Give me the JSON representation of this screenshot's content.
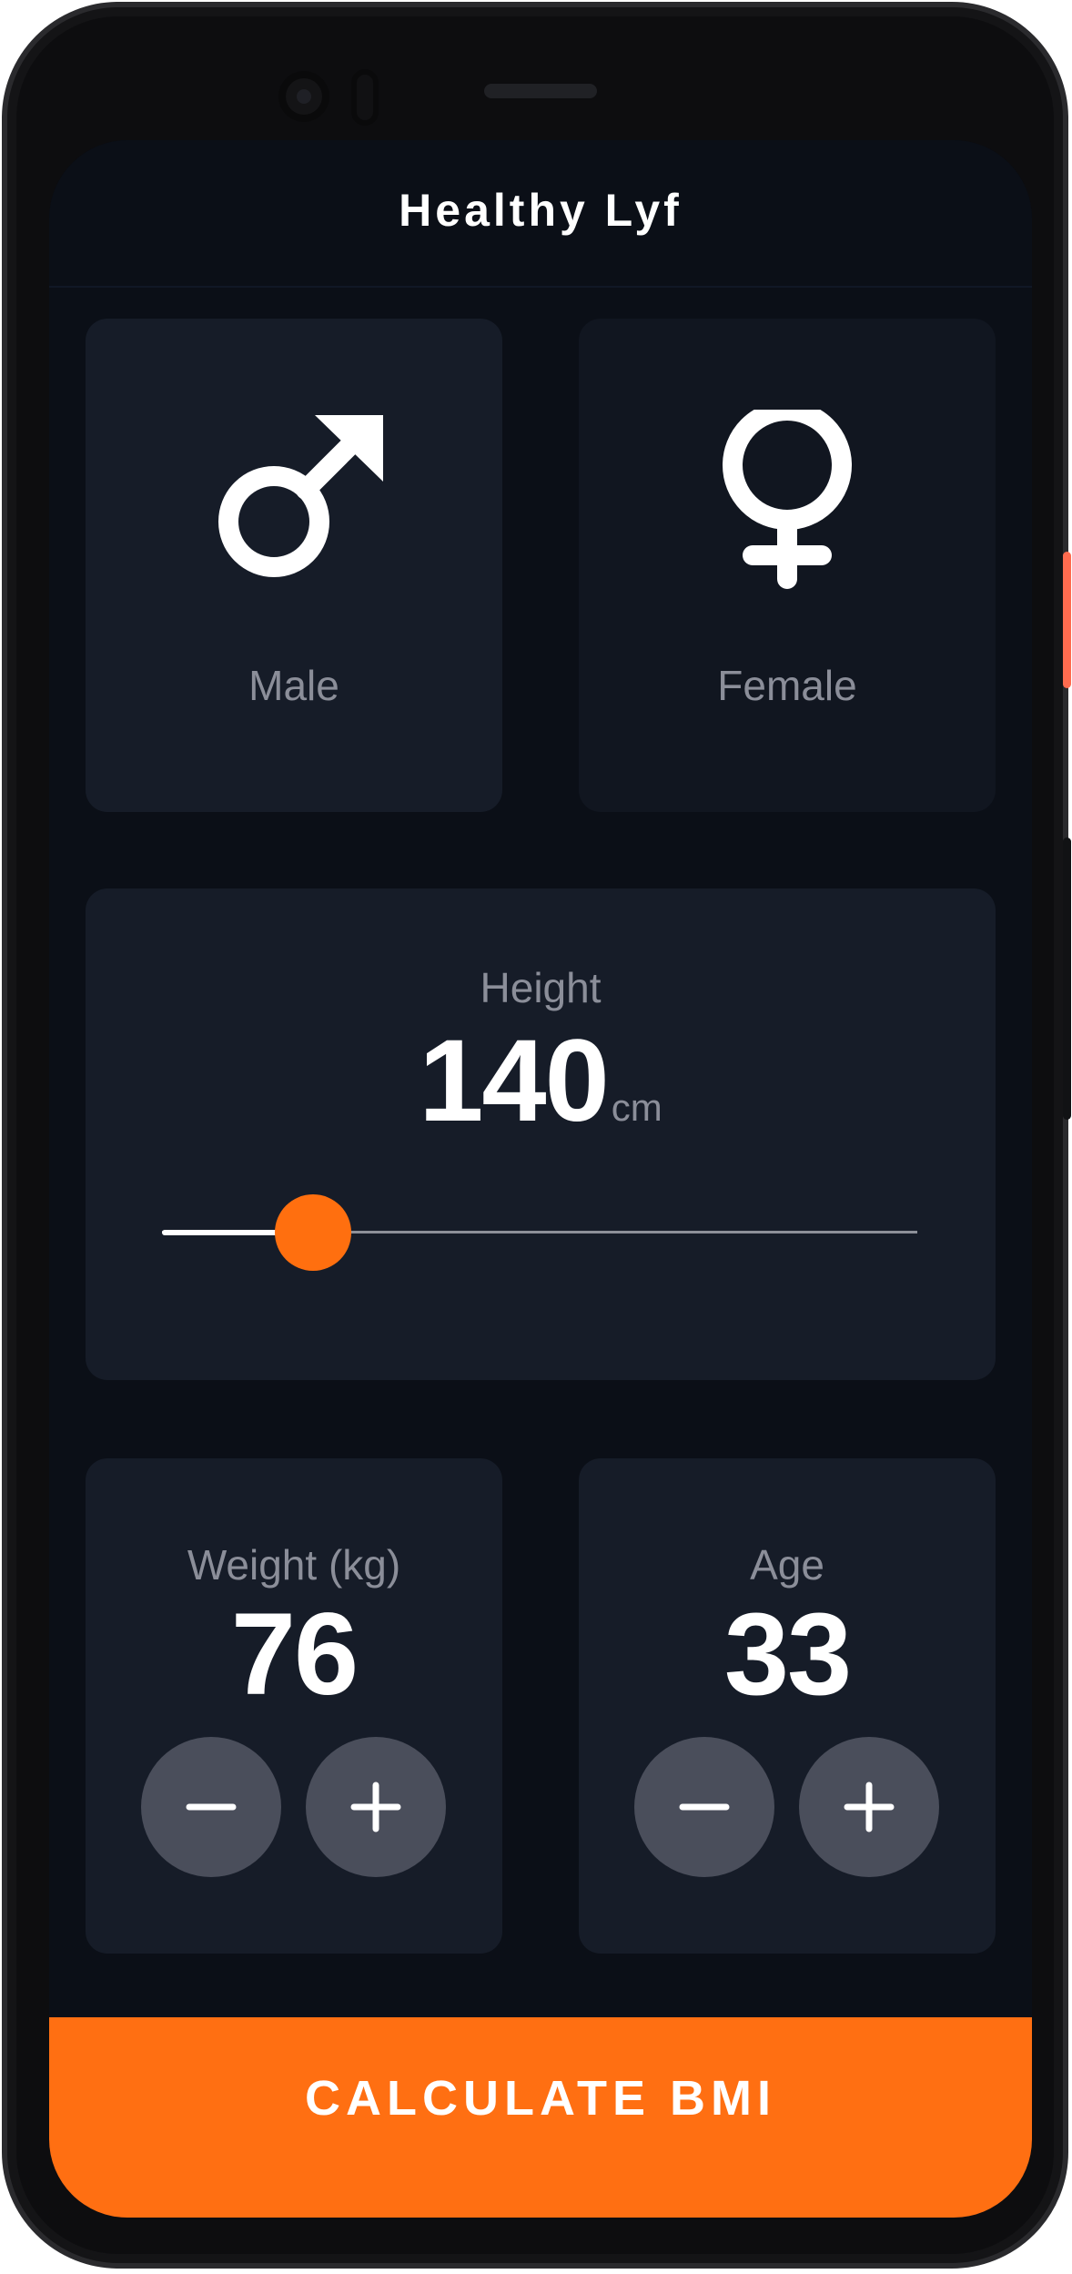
{
  "app": {
    "title": "Healthy Lyf"
  },
  "gender": {
    "male_label": "Male",
    "female_label": "Female",
    "selected": "male",
    "icons": {
      "male": "male-symbol-icon",
      "female": "female-symbol-icon"
    }
  },
  "height": {
    "label": "Height",
    "value": "140",
    "unit": "cm",
    "slider_fraction": 0.2
  },
  "weight": {
    "label": "Weight (kg)",
    "value": "76"
  },
  "age": {
    "label": "Age",
    "value": "33"
  },
  "controls": {
    "minus_icon": "minus-icon",
    "plus_icon": "plus-icon"
  },
  "calculate": {
    "label": "CALCULATE BMI"
  },
  "colors": {
    "accent": "#ff6f12",
    "background": "#0b0f17",
    "card_active": "#161c28",
    "card_inactive": "#111620",
    "muted_text": "#8b8e99"
  }
}
